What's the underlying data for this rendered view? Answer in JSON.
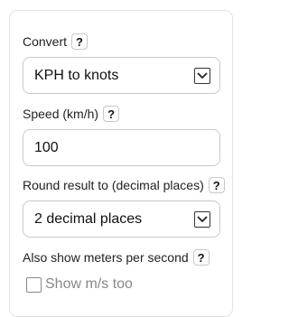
{
  "convert": {
    "label": "Convert",
    "help": "?",
    "selected": "KPH to knots"
  },
  "speed": {
    "label": "Speed (km/h)",
    "help": "?",
    "value": "100"
  },
  "round": {
    "label": "Round result to (decimal places)",
    "help": "?",
    "selected": "2 decimal places"
  },
  "mps": {
    "label": "Also show meters per second",
    "help": "?",
    "checkbox_label": "Show m/s too",
    "checked": false
  }
}
